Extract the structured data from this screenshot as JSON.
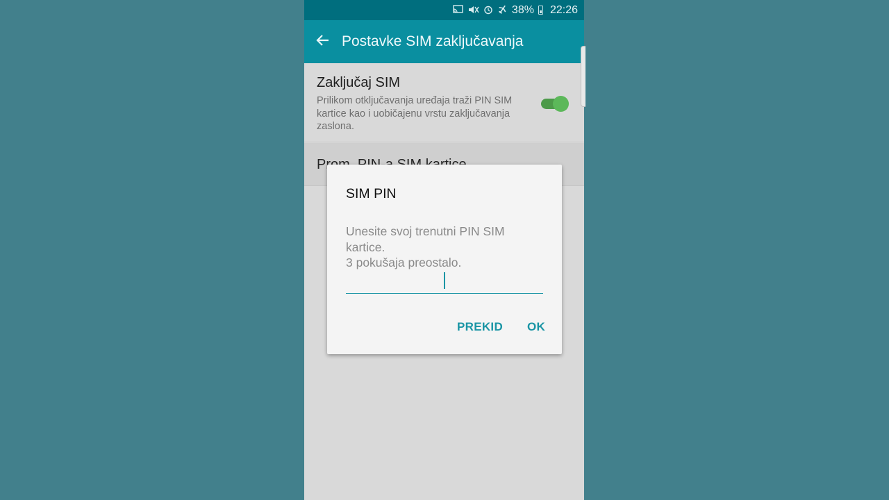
{
  "status_bar": {
    "battery": "38%",
    "time": "22:26",
    "icons": [
      "cast-icon",
      "mute-icon",
      "alarm-icon",
      "airplane-mode-icon",
      "battery-icon"
    ]
  },
  "app_bar": {
    "title": "Postavke SIM zaključavanja",
    "back_icon": "back-arrow-icon"
  },
  "settings": {
    "lock_sim": {
      "title": "Zaključaj SIM",
      "description": "Prilikom otključavanja uređaja traži PIN SIM kartice kao i uobičajenu vrstu zaključavanja zaslona.",
      "enabled": true
    },
    "change_pin": {
      "title": "Prom. PIN-a SIM kartice"
    }
  },
  "dialog": {
    "title": "SIM PIN",
    "message_line1": "Unesite svoj trenutni PIN SIM",
    "message_line2": "kartice.",
    "message_line3": "3 pokušaja preostalo.",
    "input_value": "",
    "cancel_label": "PREKID",
    "ok_label": "OK"
  },
  "colors": {
    "background": "#42808c",
    "status_bar": "#006e7e",
    "app_bar": "#0a8fa0",
    "accent": "#1a95a5",
    "toggle_on": "#5cb85a"
  }
}
